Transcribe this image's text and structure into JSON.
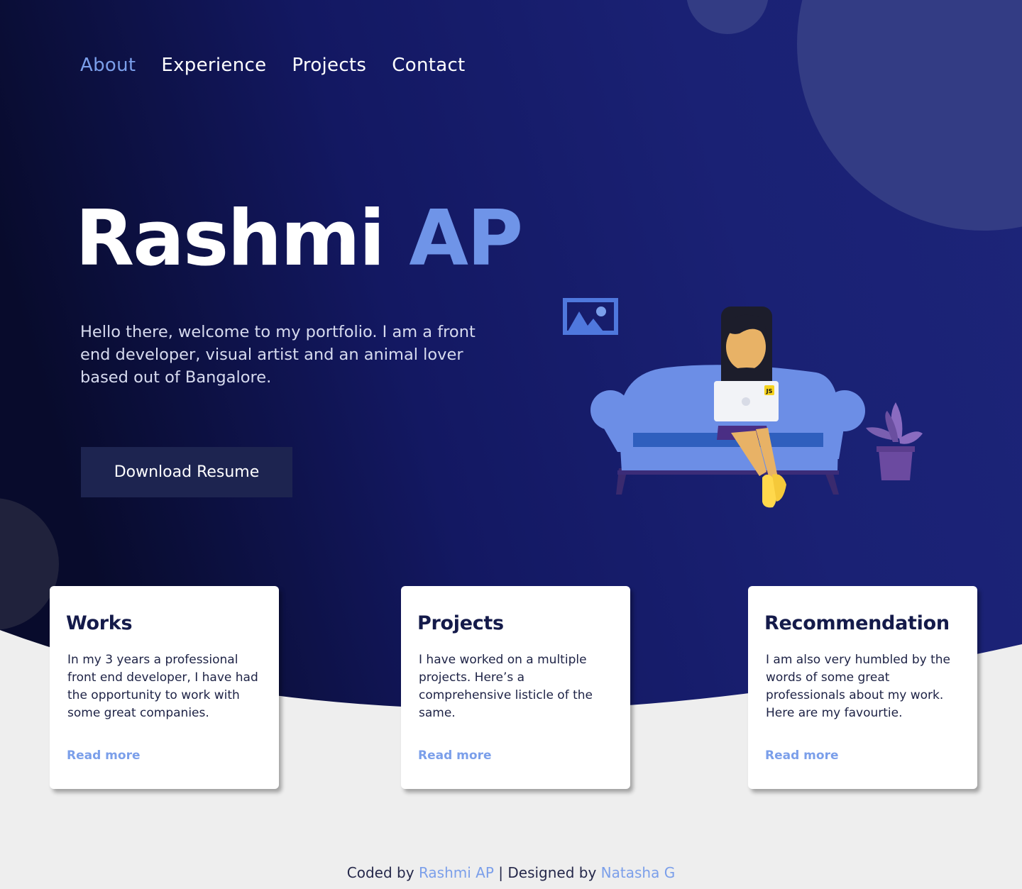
{
  "nav": {
    "items": [
      {
        "label": "About",
        "active": true
      },
      {
        "label": "Experience",
        "active": false
      },
      {
        "label": "Projects",
        "active": false
      },
      {
        "label": "Contact",
        "active": false
      }
    ]
  },
  "hero": {
    "first_name": "Rashmi",
    "last_name": "AP",
    "intro": "Hello there, welcome to my portfolio. I am a front end developer, visual artist and an animal lover based out of Bangalore.",
    "resume_button": "Download Resume",
    "illustration_icons": [
      "picture-frame-icon",
      "sofa-icon",
      "woman-with-laptop-icon",
      "potted-plant-icon"
    ],
    "laptop_badge": "JS"
  },
  "cards": [
    {
      "title": "Works",
      "body": "In my 3 years a professional front end developer, I have had the opportunity to work with some great companies.",
      "link": "Read more"
    },
    {
      "title": "Projects",
      "body": "I have worked on a multiple projects. Here’s a comprehensive listicle of the same.",
      "link": "Read more"
    },
    {
      "title": "Recommendation",
      "body": "I am also very humbled by the words of some great professionals about my work. Here are my favourtie.",
      "link": "Read more"
    }
  ],
  "footer": {
    "coded_prefix": "Coded by",
    "coder": "Rashmi AP",
    "separator": "|",
    "designed_prefix": "Designed by",
    "designer": "Natasha G"
  },
  "colors": {
    "hero_dark": "#080b2c",
    "hero_blue": "#1a2174",
    "accent": "#7b9fea",
    "page_bg": "#eeeeee",
    "button_bg": "#1d2450"
  }
}
